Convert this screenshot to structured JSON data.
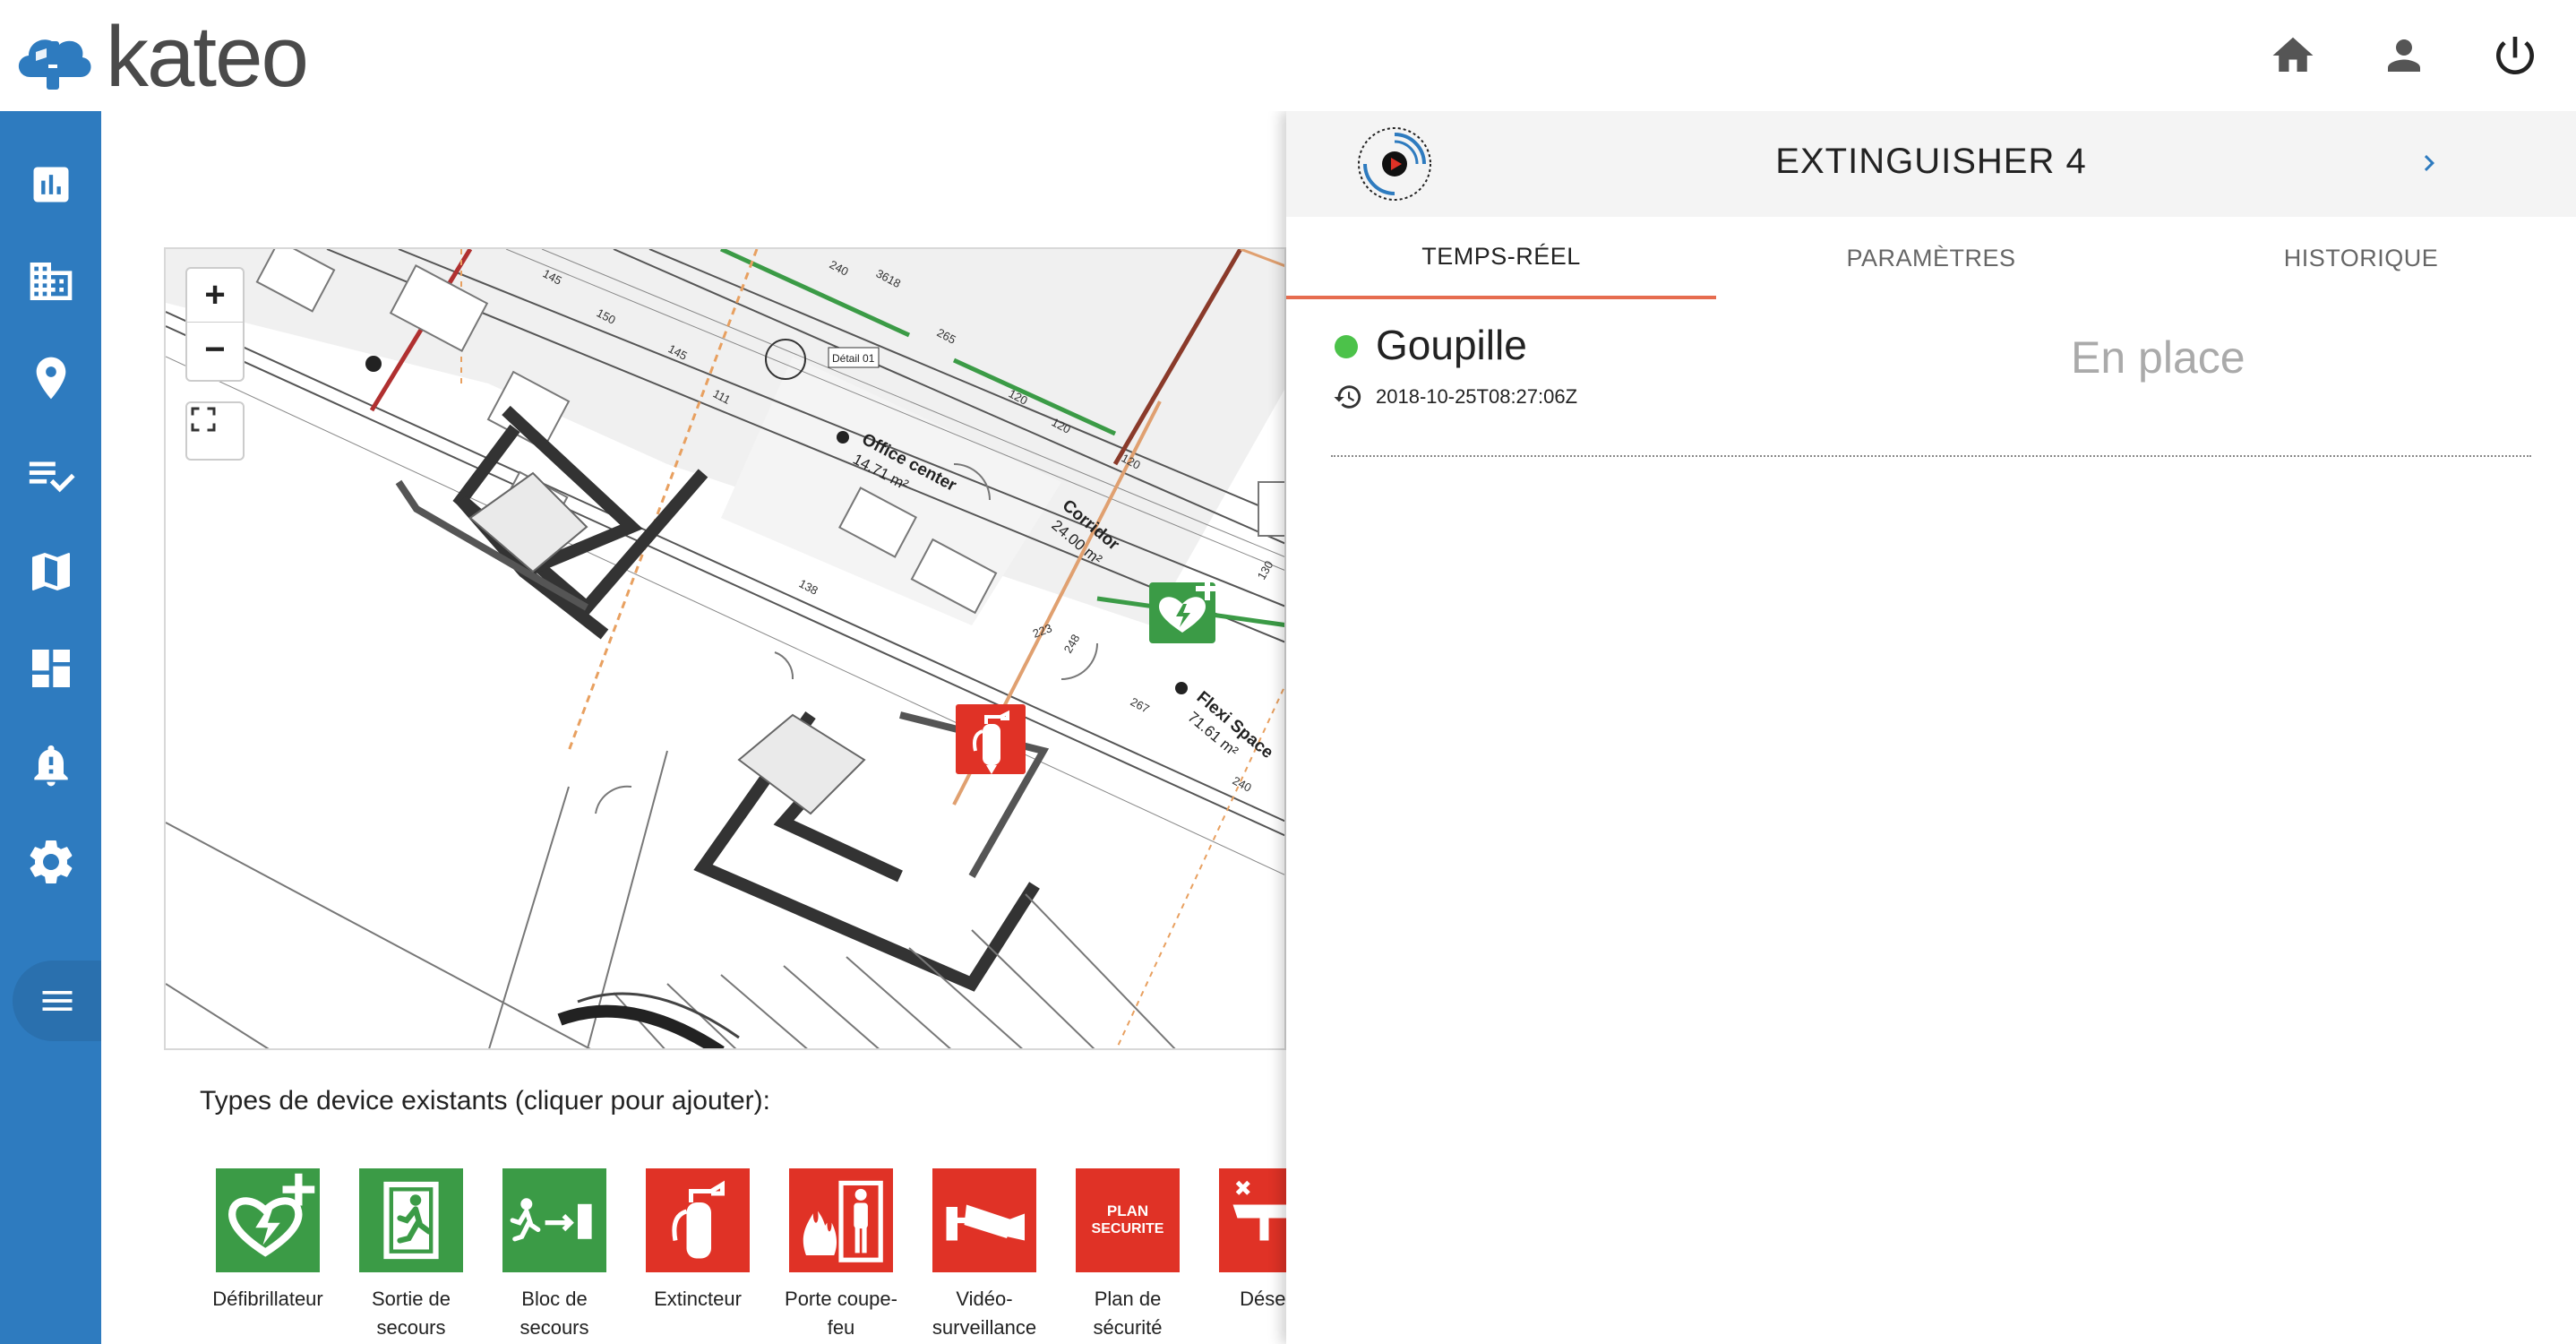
{
  "header": {
    "logo_text": "kateo",
    "icons": [
      "home-icon",
      "user-icon",
      "power-icon"
    ]
  },
  "sidebar": {
    "items": [
      {
        "icon": "dashboard-chart-icon"
      },
      {
        "icon": "building-icon"
      },
      {
        "icon": "location-pin-icon"
      },
      {
        "icon": "checklist-icon"
      },
      {
        "icon": "map-icon"
      },
      {
        "icon": "grid-layout-icon"
      },
      {
        "icon": "alarm-bell-icon"
      },
      {
        "icon": "settings-gear-icon"
      }
    ],
    "menu_icon": "hamburger-menu-icon"
  },
  "map": {
    "zoom_in": "+",
    "zoom_out": "−",
    "labels": {
      "office_center": "Office center",
      "office_center_area": "14.71 m²",
      "corridor": "Corridor",
      "corridor_area": "24.00 m²",
      "flexi_space": "Flexi Space",
      "flexi_space_area": "71.61 m²",
      "detail": "Détail 01",
      "dims": [
        "145",
        "150",
        "145",
        "111",
        "240",
        "3618",
        "265",
        "120",
        "120",
        "120",
        "130",
        "223",
        "248",
        "267",
        "240",
        "138"
      ]
    }
  },
  "device_types": {
    "title": "Types de device existants (cliquer pour ajouter):",
    "items": [
      {
        "label_line1": "Défibrillateur",
        "label_line2": "",
        "color": "#3b9b46",
        "icon": "defibrillator-icon"
      },
      {
        "label_line1": "Sortie de",
        "label_line2": "secours",
        "color": "#3b9b46",
        "icon": "emergency-exit-icon"
      },
      {
        "label_line1": "Bloc de",
        "label_line2": "secours",
        "color": "#3b9b46",
        "icon": "exit-block-icon"
      },
      {
        "label_line1": "Extincteur",
        "label_line2": "",
        "color": "#e03226",
        "icon": "extinguisher-icon"
      },
      {
        "label_line1": "Porte coupe-",
        "label_line2": "feu",
        "color": "#e03226",
        "icon": "fire-door-icon"
      },
      {
        "label_line1": "Vidéo-",
        "label_line2": "surveillance",
        "color": "#e03226",
        "icon": "camera-icon"
      },
      {
        "label_line1": "Plan de",
        "label_line2": "sécurité",
        "color": "#e03226",
        "icon": "safety-plan-icon",
        "badge_line1": "PLAN",
        "badge_line2": "SECURITE"
      },
      {
        "label_line1": "Désenf",
        "label_line2": "",
        "color": "#e03226",
        "icon": "smoke-vent-icon"
      }
    ]
  },
  "panel": {
    "title": "EXTINGUISHER 4",
    "tabs": [
      {
        "label": "TEMPS-RÉEL",
        "active": true
      },
      {
        "label": "PARAMÈTRES",
        "active": false
      },
      {
        "label": "HISTORIQUE",
        "active": false
      }
    ],
    "status": {
      "name": "Goupille",
      "timestamp": "2018-10-25T08:27:06Z",
      "value": "En place",
      "dot_color": "#4cc24a"
    }
  },
  "colors": {
    "sidebar": "#2e7bbf",
    "accent": "#e66c4f",
    "green": "#3b9b46",
    "red": "#e03226"
  }
}
